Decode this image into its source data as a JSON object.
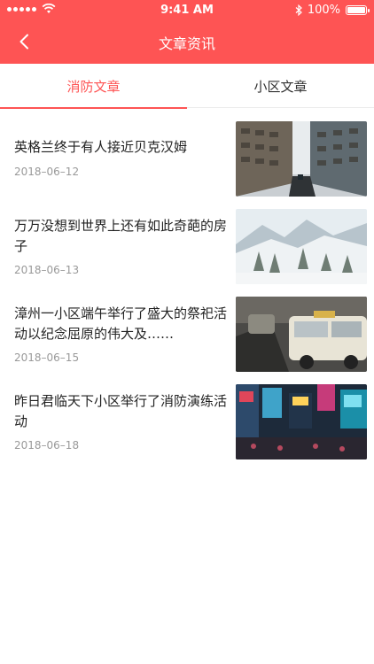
{
  "status_bar": {
    "time": "9:41 AM",
    "battery": "100%"
  },
  "nav": {
    "title": "文章资讯"
  },
  "tabs": [
    {
      "label": "消防文章",
      "active": true
    },
    {
      "label": "小区文章",
      "active": false
    }
  ],
  "articles": [
    {
      "title": "英格兰终于有人接近贝克汉姆",
      "date": "2018–06–12",
      "image": "city-street-buildings"
    },
    {
      "title": "万万没想到世界上还有如此奇葩的房子",
      "date": "2018–06–13",
      "image": "snowy-mountain-trees"
    },
    {
      "title": "漳州一小区端午举行了盛大的祭祀活动以纪念屈原的伟大及……",
      "date": "2018–06–15",
      "image": "taxi-street"
    },
    {
      "title": "昨日君临天下小区举行了消防演练活动",
      "date": "2018–06–18",
      "image": "neon-city-night"
    }
  ],
  "colors": {
    "accent": "#fe5454"
  }
}
